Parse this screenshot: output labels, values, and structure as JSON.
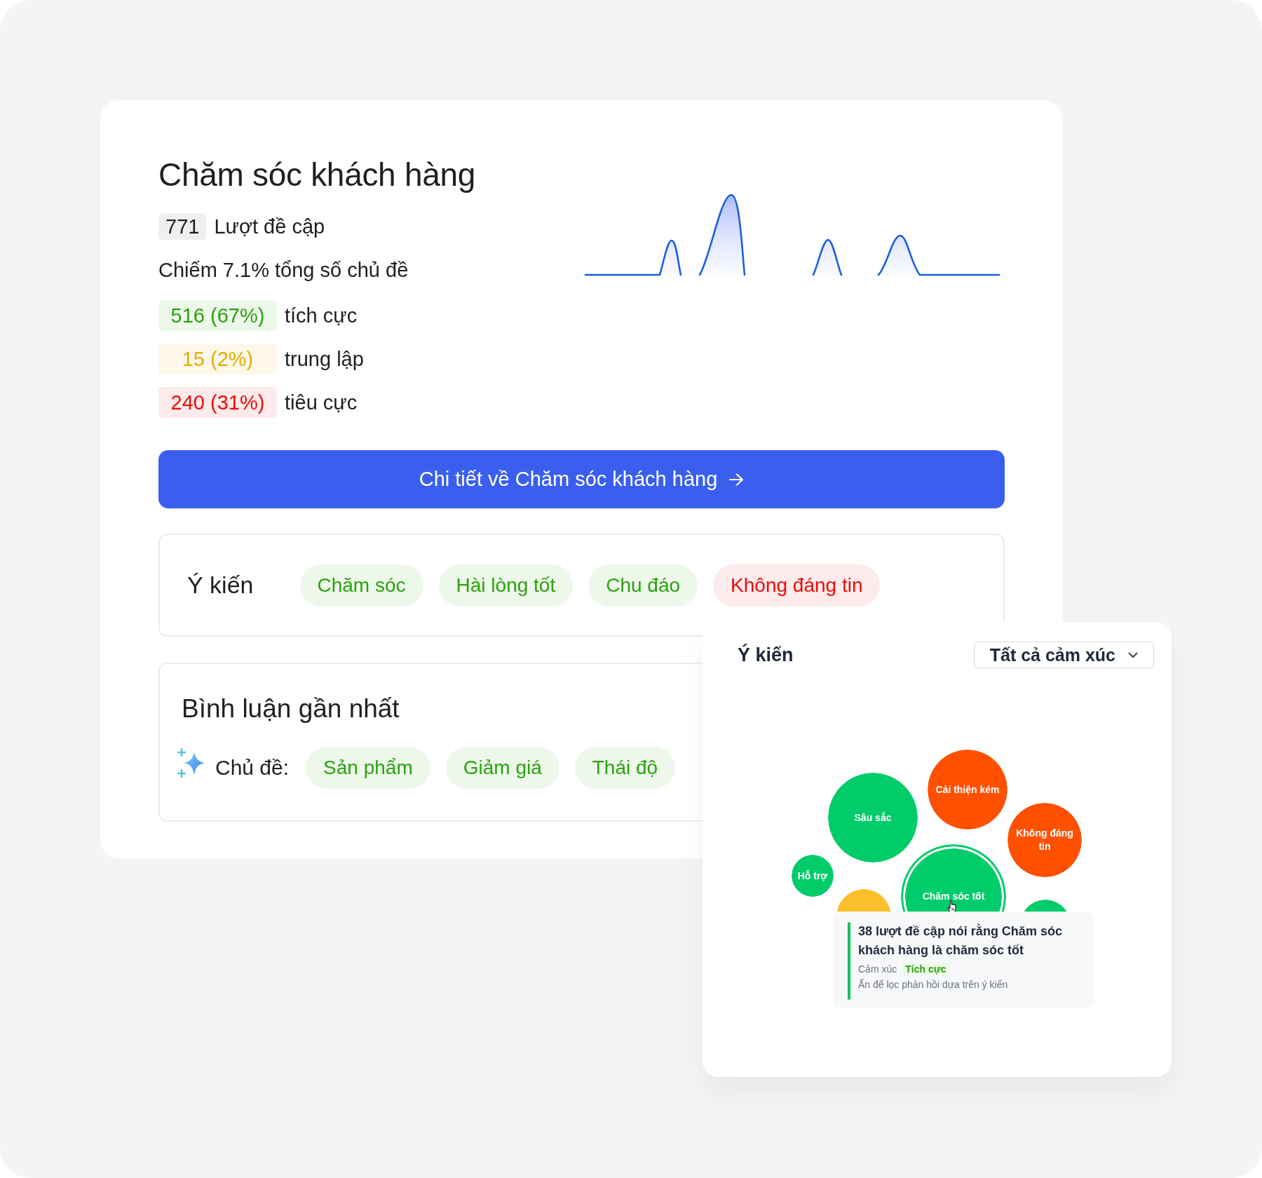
{
  "topic": {
    "title": "Chăm sóc khách hàng",
    "mentions": {
      "count": "771",
      "label": "Lượt đề cập"
    },
    "share": "Chiếm 7.1% tổng số chủ đề",
    "sentiments": [
      {
        "count": "516 (67%)",
        "label": "tích cực",
        "kind": "positive"
      },
      {
        "count": "15 (2%)",
        "label": "trung lập",
        "kind": "neutral"
      },
      {
        "count": "240 (31%)",
        "label": "tiêu cực",
        "kind": "negative"
      }
    ],
    "detail_button": {
      "label": "Chi tiết về Chăm sóc khách hàng"
    }
  },
  "opinions": {
    "title": "Ý kiến",
    "tags": [
      {
        "label": "Chăm sóc",
        "kind": "positive"
      },
      {
        "label": "Hài lòng tốt",
        "kind": "positive"
      },
      {
        "label": "Chu đáo",
        "kind": "positive"
      },
      {
        "label": "Không đáng tin",
        "kind": "negative"
      }
    ]
  },
  "recent_comments": {
    "title": "Bình luận gần nhất",
    "topics_label": "Chủ đề:",
    "topics": [
      {
        "label": "Sản phẩm",
        "kind": "positive"
      },
      {
        "label": "Giảm giá",
        "kind": "positive"
      },
      {
        "label": "Thái độ",
        "kind": "positive"
      }
    ]
  },
  "opinion_panel": {
    "title": "Ý kiến",
    "filter": {
      "value": "Tất cả cảm xúc"
    },
    "bubbles": [
      {
        "label": "Sâu sắc",
        "color": "#00cc6a",
        "selected": false
      },
      {
        "label": "Cải thiện kém",
        "color": "#ff5000",
        "selected": false
      },
      {
        "label": "Không đáng tin",
        "color": "#ff5000",
        "selected": false
      },
      {
        "label": "Hỗ trợ",
        "color": "#00cc6a",
        "selected": false
      },
      {
        "label": "Chăm sóc tốt",
        "color": "#00cc6a",
        "selected": true
      },
      {
        "color": "#fbbf2c",
        "selected": false
      },
      {
        "color": "#00cc6a",
        "selected": false
      }
    ],
    "tooltip": {
      "text": "38 lượt đề cập nói rằng Chăm sóc khách hàng là chăm sóc tốt",
      "sentiment": {
        "label": "Cảm xúc",
        "value": "Tích cực",
        "kind": "positive"
      },
      "hint": "Ấn để lọc phản hồi dựa trên ý kiến"
    }
  }
}
